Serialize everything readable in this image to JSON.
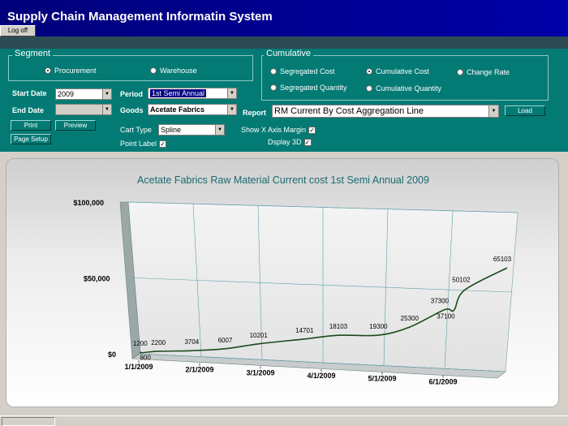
{
  "app": {
    "title": "Supply Chain Management Informatin System",
    "logoff_label": "Log off"
  },
  "segment": {
    "title": "Segment",
    "options": [
      {
        "label": "Procurement",
        "selected": true
      },
      {
        "label": "Warehouse",
        "selected": false
      }
    ]
  },
  "cumulative": {
    "title": "Cumulative",
    "options": [
      {
        "label": "Segregated Cost",
        "selected": false
      },
      {
        "label": "Cumulative Cost",
        "selected": true
      },
      {
        "label": "Change Rate",
        "selected": false
      },
      {
        "label": "Segregated Quantity",
        "selected": false
      },
      {
        "label": "Cumulative Quantity",
        "selected": false
      }
    ]
  },
  "form": {
    "start_date_label": "Start Date",
    "start_date_value": "2009",
    "end_date_label": "End Date",
    "end_date_value": "",
    "period_label": "Period",
    "period_value": "1st Semi Annual",
    "goods_label": "Goods",
    "goods_value": "Acetate Fabrics",
    "report_label": "Report",
    "report_value": "RM Current By Cost Aggregation Line",
    "chart_type_label": "Cart Type",
    "chart_type_value": "Spline",
    "point_label": "Point Label",
    "point_label_checked": true,
    "show_x_margin_label": "Show X Axis Margin",
    "show_x_margin_checked": true,
    "display_3d_label": "Dsplay 3D",
    "display_3d_checked": true
  },
  "buttons": {
    "print": "Print",
    "preview": "Preview",
    "page_setup": "Page Setup",
    "load": "Load"
  },
  "chart_data": {
    "type": "line",
    "title": "Acetate Fabrics Raw Material Current cost 1st Semi Annual 2009",
    "y_ticks": [
      "$0",
      "$50,000",
      "$100,000"
    ],
    "x_ticks": [
      "1/1/2009",
      "2/1/2009",
      "3/1/2009",
      "4/1/2009",
      "5/1/2009",
      "6/1/2009"
    ],
    "ylim": [
      0,
      100000
    ],
    "line_color": "#1a4a1a",
    "points": [
      {
        "x": 0.0,
        "y": 1200
      },
      {
        "x": 0.03,
        "y": 800
      },
      {
        "x": 0.3,
        "y": 2200
      },
      {
        "x": 0.85,
        "y": 3704
      },
      {
        "x": 1.4,
        "y": 6007
      },
      {
        "x": 1.95,
        "y": 10201
      },
      {
        "x": 2.7,
        "y": 14701
      },
      {
        "x": 3.25,
        "y": 18103
      },
      {
        "x": 3.9,
        "y": 19300
      },
      {
        "x": 4.4,
        "y": 25300
      },
      {
        "x": 4.95,
        "y": 37300
      },
      {
        "x": 5.1,
        "y": 37100
      },
      {
        "x": 5.25,
        "y": 50102
      },
      {
        "x": 5.9,
        "y": 65103
      }
    ],
    "labels": [
      "1200",
      "800",
      "2200",
      "3704",
      "6007",
      "10201",
      "14701",
      "18103",
      "19300",
      "25300",
      "37300",
      "37100",
      "50102",
      "65103"
    ]
  }
}
